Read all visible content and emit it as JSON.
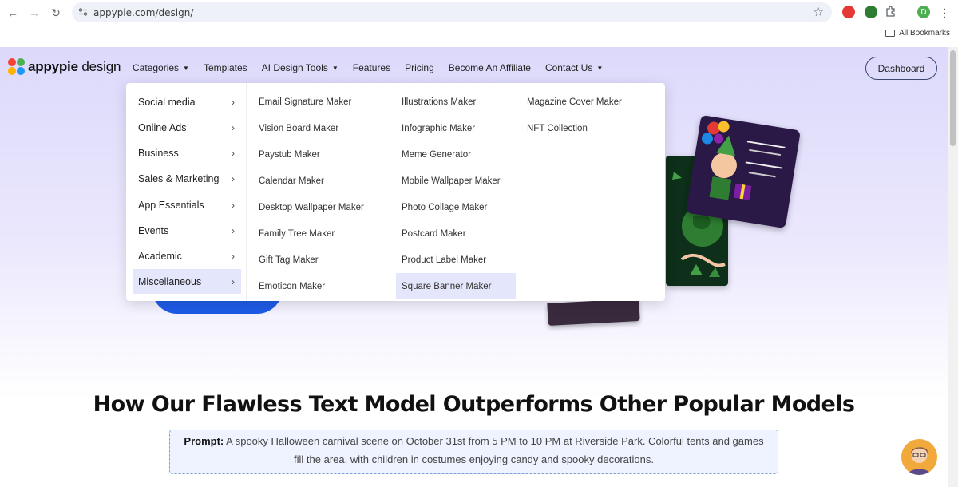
{
  "browser": {
    "url": "appypie.com/design/",
    "bookmarks_label": "All Bookmarks",
    "profile_initial": "D"
  },
  "header": {
    "logo_brand": "appypie",
    "logo_suffix": " design",
    "nav": [
      "Categories",
      "Templates",
      "AI Design Tools",
      "Features",
      "Pricing",
      "Become An Affiliate",
      "Contact Us"
    ],
    "dashboard_label": "Dashboard"
  },
  "mega_menu": {
    "categories": [
      "Social media",
      "Online Ads",
      "Business",
      "Sales & Marketing",
      "App Essentials",
      "Events",
      "Academic",
      "Miscellaneous"
    ],
    "active_category": "Miscellaneous",
    "columns": [
      [
        "Email Signature Maker",
        "Vision Board Maker",
        "Paystub Maker",
        "Calendar Maker",
        "Desktop Wallpaper Maker",
        "Family Tree Maker",
        "Gift Tag Maker",
        "Emoticon Maker"
      ],
      [
        "Illustrations Maker",
        "Infographic Maker",
        "Meme Generator",
        "Mobile Wallpaper Maker",
        "Photo Collage Maker",
        "Postcard Maker",
        "Product Label Maker",
        "Square Banner Maker"
      ],
      [
        "Magazine Cover Maker",
        "NFT Collection"
      ]
    ],
    "active_link": "Square Banner Maker"
  },
  "main": {
    "headline": "How Our Flawless Text Model Outperforms Other Popular Models",
    "prompt_label": "Prompt:",
    "prompt_text": " A spooky Halloween carnival scene on October 31st from 5 PM to 10 PM at Riverside Park. Colorful tents and games fill the area, with children in costumes enjoying candy and spooky decorations."
  },
  "colors": {
    "accent": "#1e5be6",
    "menu_highlight": "#e4e6fb"
  }
}
